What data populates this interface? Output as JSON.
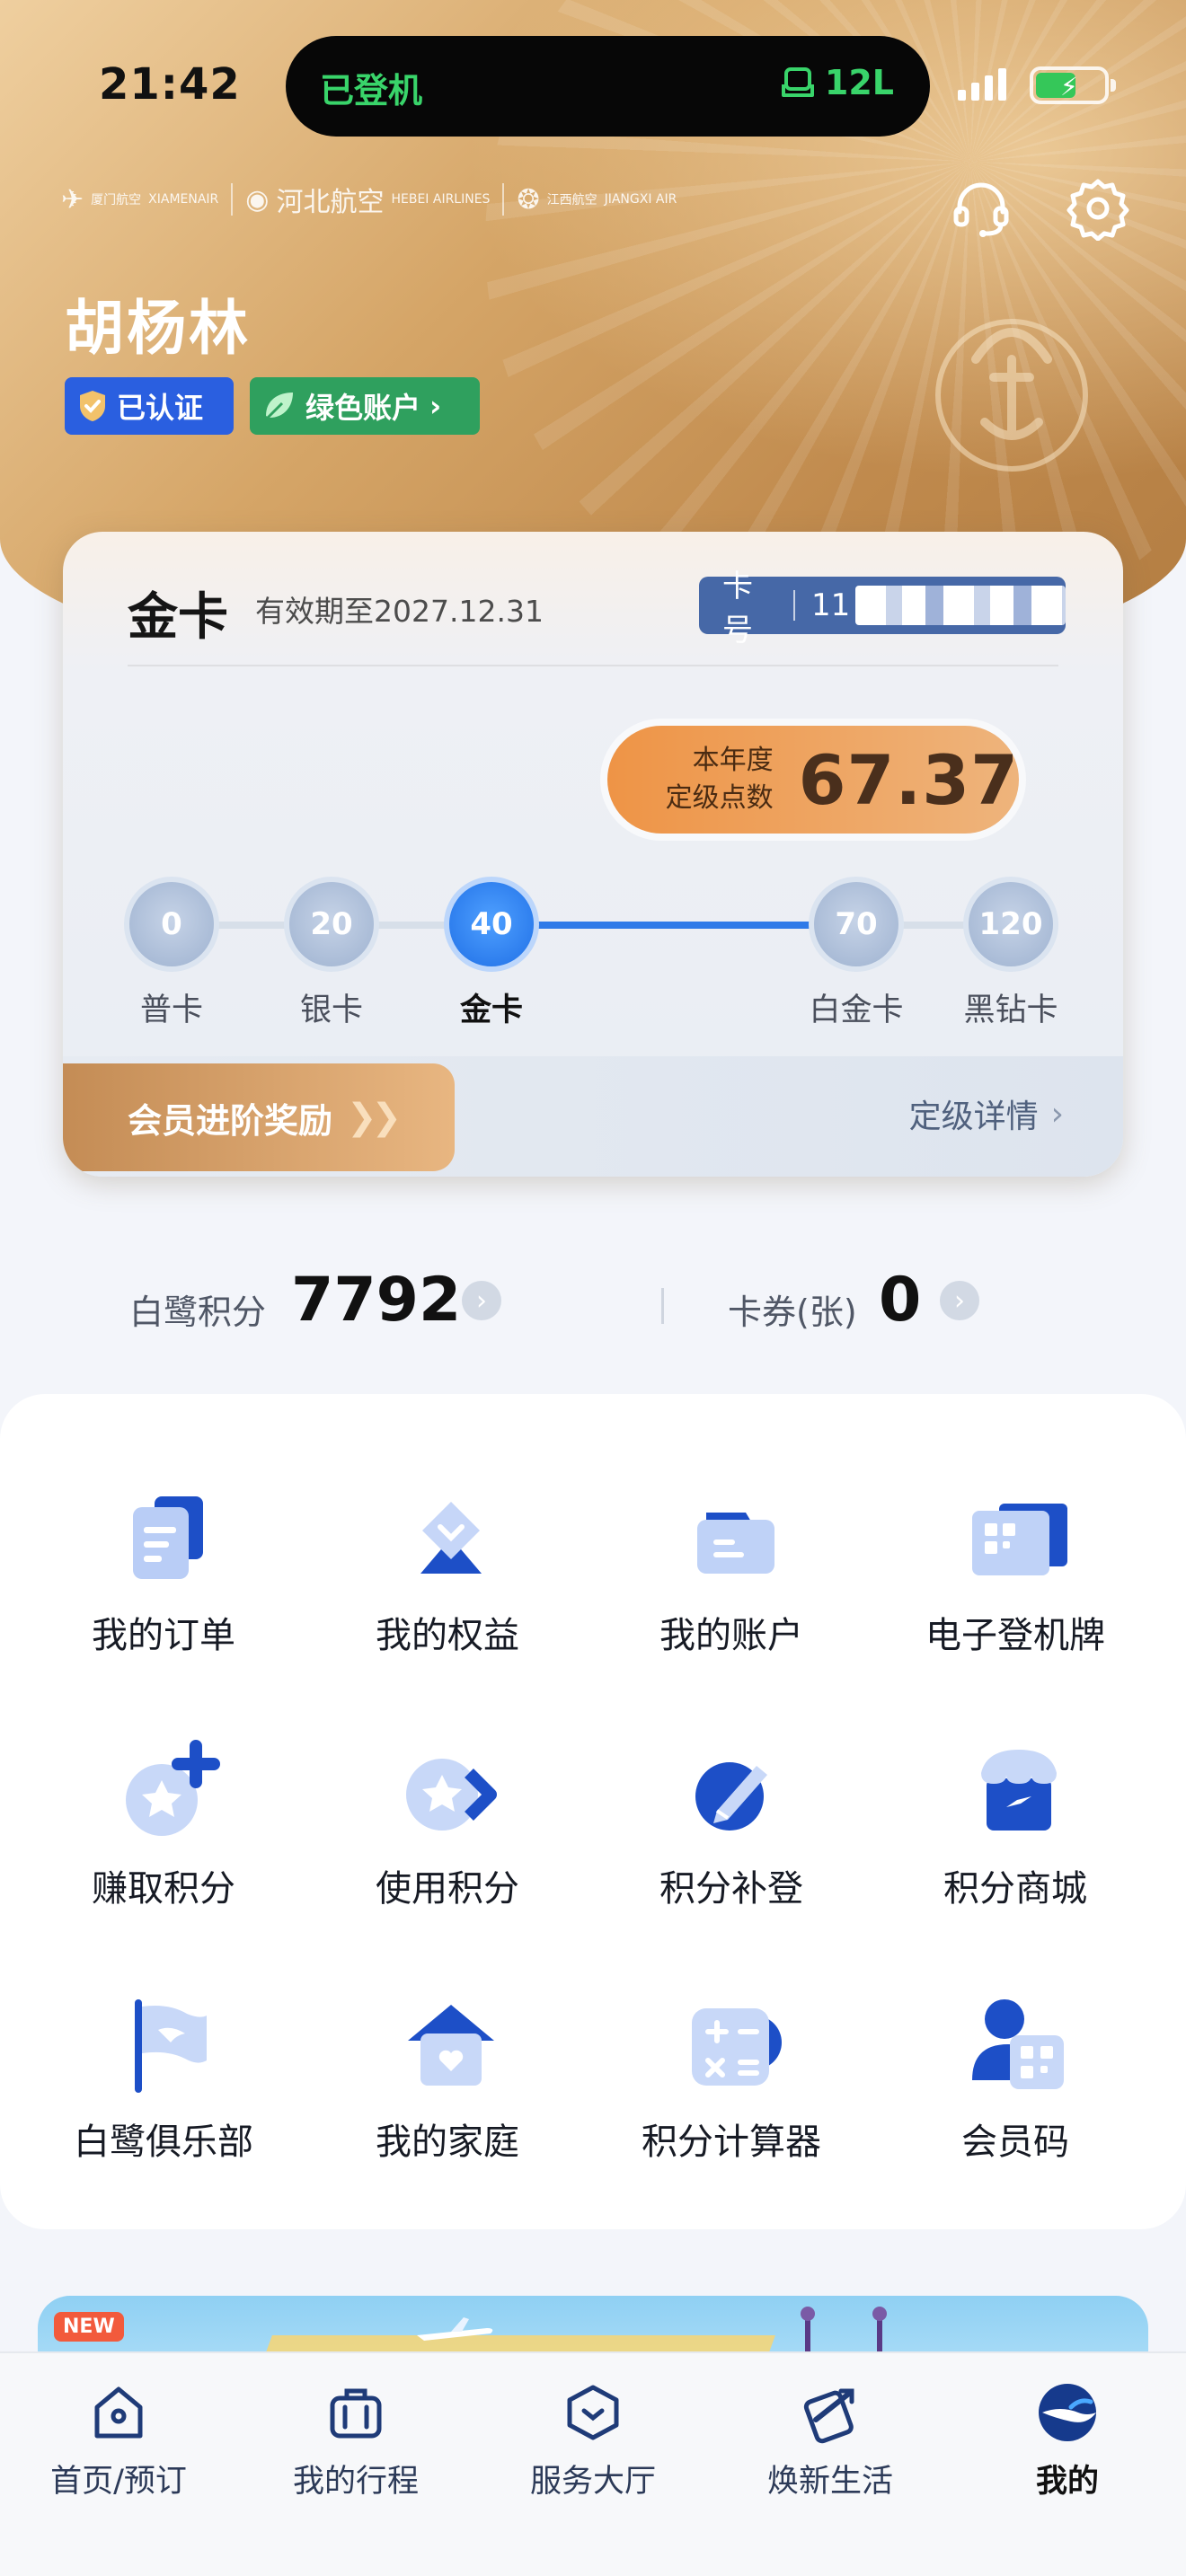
{
  "status_bar": {
    "time": "21:42",
    "flight_status": "已登机",
    "gate": "12L"
  },
  "header": {
    "airlines": [
      "XIAMENAIR",
      "HEBEI AIRLINES",
      "JIANGXI AIR"
    ],
    "airline_texts": {
      "xiamen_cn": "厦门航空",
      "xiamen_en": "XIAMENAIR",
      "hebei_cn": "河北航空",
      "hebei_en": "HEBEI AIRLINES",
      "jiangxi_cn": "江西航空",
      "jiangxi_en": "JIANGXI AIR"
    },
    "icons": [
      "headset-icon",
      "gear-icon"
    ]
  },
  "user": {
    "name": "胡杨林",
    "verified_label": "已认证",
    "green_account_label": "绿色账户"
  },
  "card": {
    "tier": "金卡",
    "valid_until": "有效期至2027.12.31",
    "card_no_label": "卡号",
    "card_no_visible": "11",
    "points_label_line1": "本年度",
    "points_label_line2": "定级点数",
    "points_value": "67.37",
    "levels": [
      {
        "threshold": "0",
        "name": "普卡"
      },
      {
        "threshold": "20",
        "name": "银卡"
      },
      {
        "threshold": "40",
        "name": "金卡"
      },
      {
        "threshold": "70",
        "name": "白金卡"
      },
      {
        "threshold": "120",
        "name": "黑钻卡"
      }
    ],
    "current_level_index": 2,
    "reward_label": "会员进阶奖励",
    "detail_label": "定级详情"
  },
  "summary": {
    "points_label": "白鹭积分",
    "points_value": "7792",
    "coupons_label": "卡券(张)",
    "coupons_value": "0"
  },
  "features": [
    {
      "label": "我的订单",
      "icon": "order-icon"
    },
    {
      "label": "我的权益",
      "icon": "diamond-icon"
    },
    {
      "label": "我的账户",
      "icon": "wallet-icon"
    },
    {
      "label": "电子登机牌",
      "icon": "boarding-pass-icon"
    },
    {
      "label": "赚取积分",
      "icon": "earn-points-icon"
    },
    {
      "label": "使用积分",
      "icon": "use-points-icon"
    },
    {
      "label": "积分补登",
      "icon": "points-claim-icon"
    },
    {
      "label": "积分商城",
      "icon": "points-mall-icon"
    },
    {
      "label": "白鹭俱乐部",
      "icon": "egret-club-flag-icon"
    },
    {
      "label": "我的家庭",
      "icon": "family-home-icon"
    },
    {
      "label": "积分计算器",
      "icon": "calculator-icon"
    },
    {
      "label": "会员码",
      "icon": "member-code-icon"
    }
  ],
  "banner": {
    "tag": "NEW"
  },
  "tabbar": {
    "tabs": [
      {
        "label": "首页/预订",
        "icon": "home-icon"
      },
      {
        "label": "我的行程",
        "icon": "luggage-icon"
      },
      {
        "label": "服务大厅",
        "icon": "service-hall-icon"
      },
      {
        "label": "焕新生活",
        "icon": "lifestyle-icon"
      },
      {
        "label": "我的",
        "icon": "egret-logo-icon"
      }
    ],
    "active_index": 4
  },
  "colors": {
    "accent_blue": "#2f7ae8",
    "gold": "#c9955a",
    "points_orange": "#ee9446",
    "verified_blue": "#2a5fe0",
    "green": "#2fa05e",
    "island_green": "#39d46a"
  }
}
